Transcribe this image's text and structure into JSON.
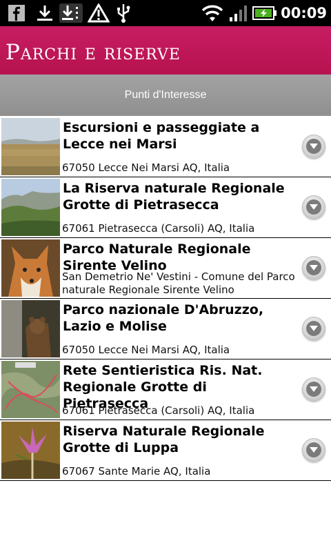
{
  "status_bar": {
    "time": "00:09",
    "icons": [
      "facebook-icon",
      "download-icon",
      "download-queue-icon",
      "warning-icon",
      "usb-icon",
      "wifi-icon",
      "signal-icon",
      "battery-charging-icon"
    ]
  },
  "app": {
    "title": "Parchi e riserve"
  },
  "section": {
    "title": "Punti d'Interesse"
  },
  "items": [
    {
      "title": "Escursioni e passeggiate a Lecce nei Marsi",
      "subtitle": "67050 Lecce Nei Marsi AQ, Italia"
    },
    {
      "title": "La Riserva naturale Regionale Grotte di Pietrasecca",
      "subtitle": "67061 Pietrasecca (Carsoli) AQ, Italia"
    },
    {
      "title": "Parco Naturale Regionale Sirente Velino",
      "subtitle": "San Demetrio Ne' Vestini - Comune del Parco naturale Regionale Sirente Velino"
    },
    {
      "title": "Parco nazionale D'Abruzzo, Lazio e Molise",
      "subtitle": "67050 Lecce Nei Marsi AQ, Italia"
    },
    {
      "title": "Rete Sentieristica Ris. Nat. Regionale Grotte di Pietrasecca",
      "subtitle": "67061 Pietrasecca (Carsoli) AQ, Italia"
    },
    {
      "title": "Riserva Naturale Regionale Grotte di Luppa",
      "subtitle": "67067 Sante Marie AQ, Italia"
    }
  ],
  "colors": {
    "title_bar": "#c2185b",
    "section_bar": "#9a9a9a"
  }
}
